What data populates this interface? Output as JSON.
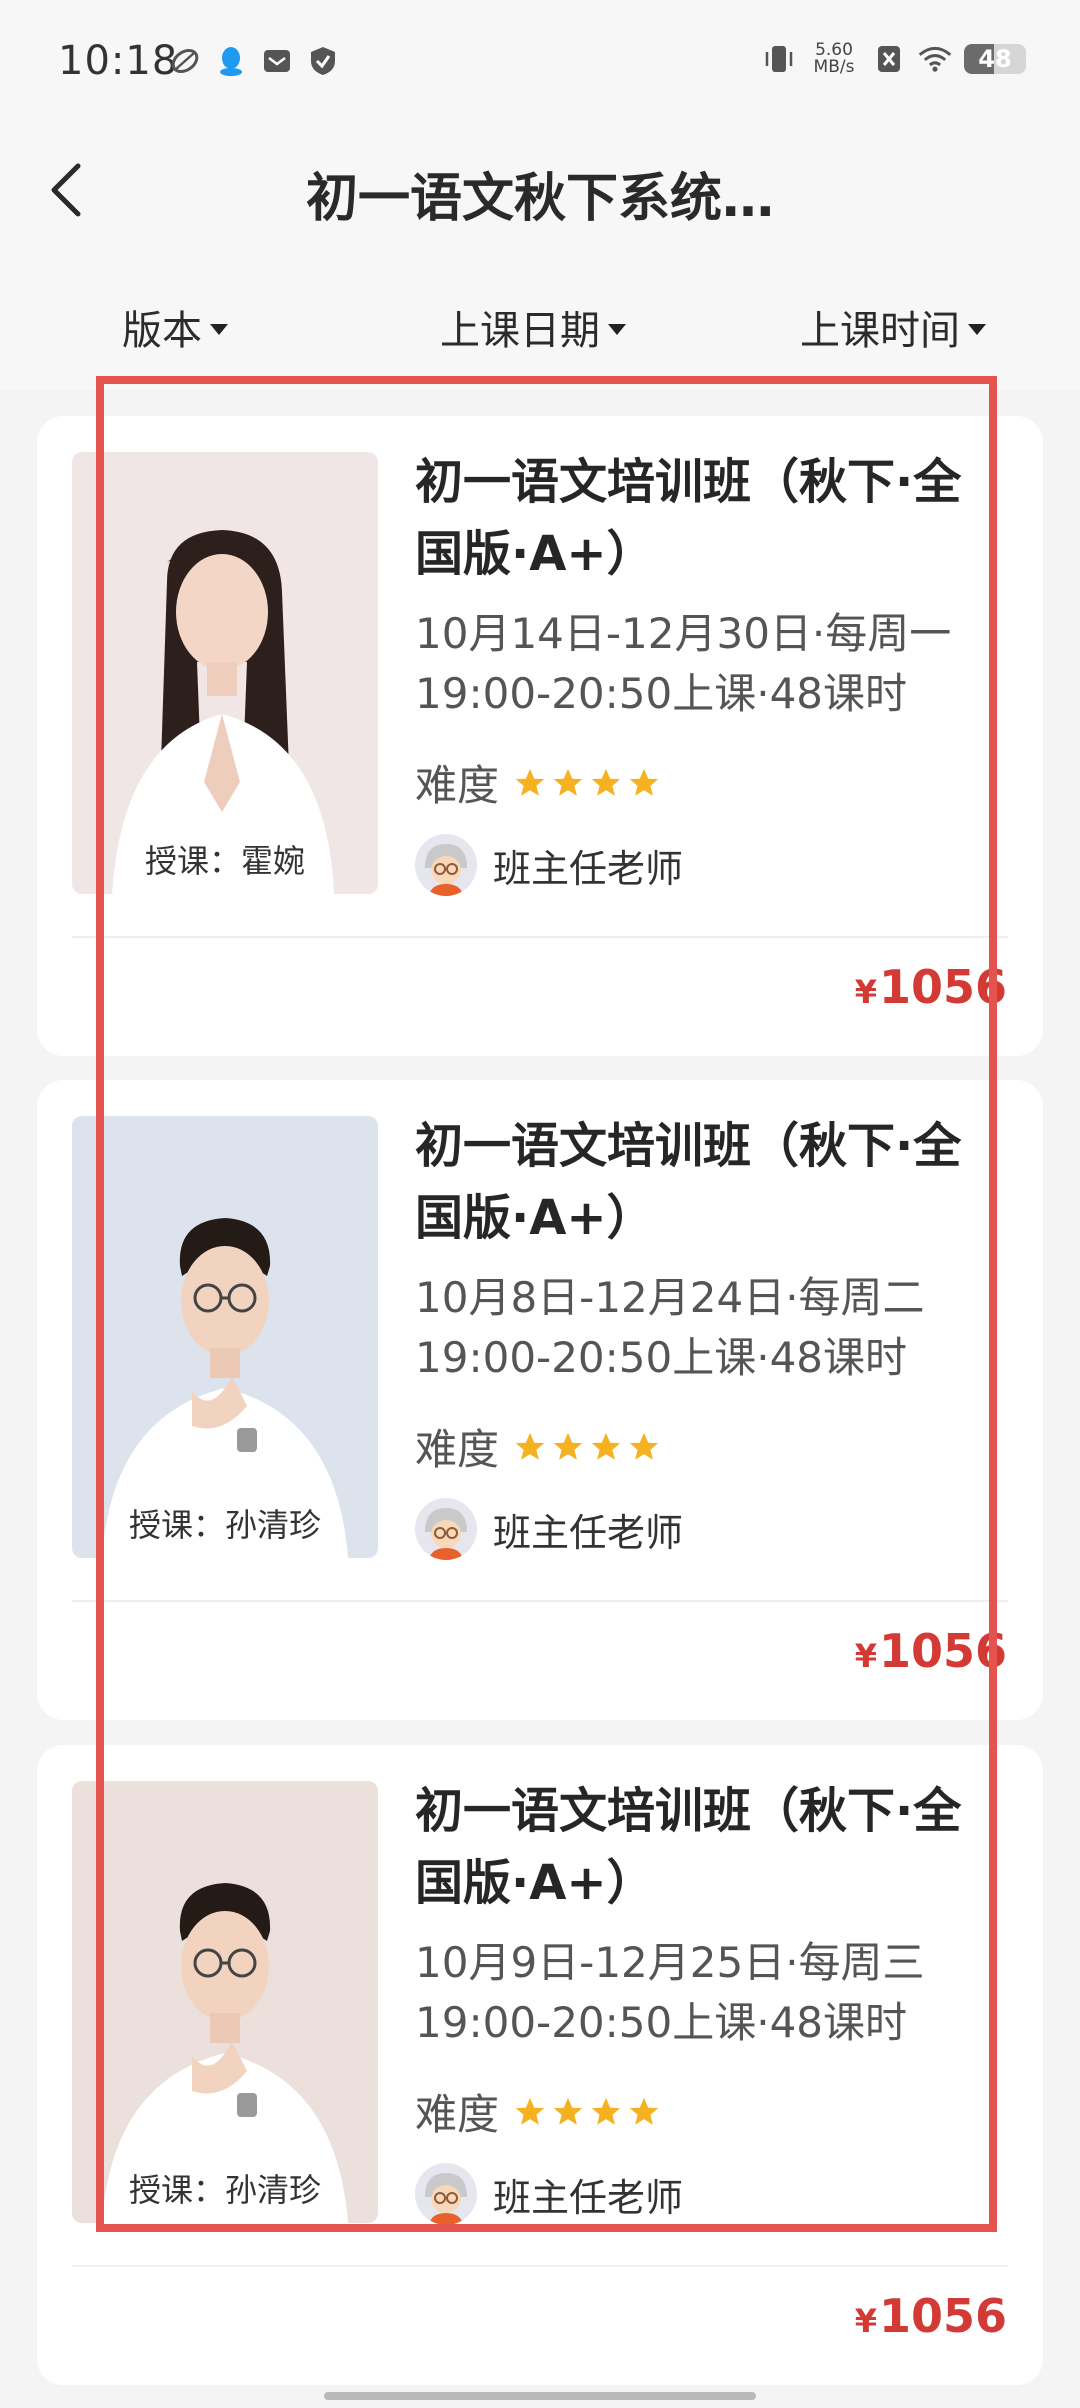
{
  "status_bar": {
    "time": "10:18",
    "net_speed_value": "5.60",
    "net_speed_unit": "MB/s",
    "battery": "48",
    "left_icons": [
      "leaf-icon",
      "qq-icon",
      "mail-icon",
      "shield-icon"
    ],
    "right_icons": [
      "vibrate-icon",
      "speed-indicator",
      "sim-off-icon",
      "wifi-icon",
      "battery-icon"
    ]
  },
  "header": {
    "title": "初一语文秋下系统…",
    "back_icon": "chevron-left-icon"
  },
  "filters": [
    {
      "label": "版本"
    },
    {
      "label": "上课日期"
    },
    {
      "label": "上课时间"
    }
  ],
  "courses": [
    {
      "title_line1": "初一语文培训班（秋下·全",
      "title_line2": "国版·A+）",
      "schedule_line1": "10月14日-12月30日·每周一",
      "schedule_line2": "19:00-20:50上课·48课时",
      "difficulty_label": "难度",
      "difficulty_stars": 4,
      "teacher_caption": "授课：霍婉",
      "head_teacher": "班主任老师",
      "price": "1056",
      "currency": "¥",
      "photo_bg": "#f1e6e6"
    },
    {
      "title_line1": "初一语文培训班（秋下·全",
      "title_line2": "国版·A+）",
      "schedule_line1": "10月8日-12月24日·每周二",
      "schedule_line2": "19:00-20:50上课·48课时",
      "difficulty_label": "难度",
      "difficulty_stars": 4,
      "teacher_caption": "授课：孙清珍",
      "head_teacher": "班主任老师",
      "price": "1056",
      "currency": "¥",
      "photo_bg": "#dce3ec"
    },
    {
      "title_line1": "初一语文培训班（秋下·全",
      "title_line2": "国版·A+）",
      "schedule_line1": "10月9日-12月25日·每周三",
      "schedule_line2": "19:00-20:50上课·48课时",
      "difficulty_label": "难度",
      "difficulty_stars": 4,
      "teacher_caption": "授课：孙清珍",
      "head_teacher": "班主任老师",
      "price": "1056",
      "currency": "¥",
      "photo_bg": "#ece0dc"
    }
  ],
  "colors": {
    "accent_red": "#d33a35",
    "star_gold": "#f5b11f",
    "highlight_box": "#e5534f"
  }
}
